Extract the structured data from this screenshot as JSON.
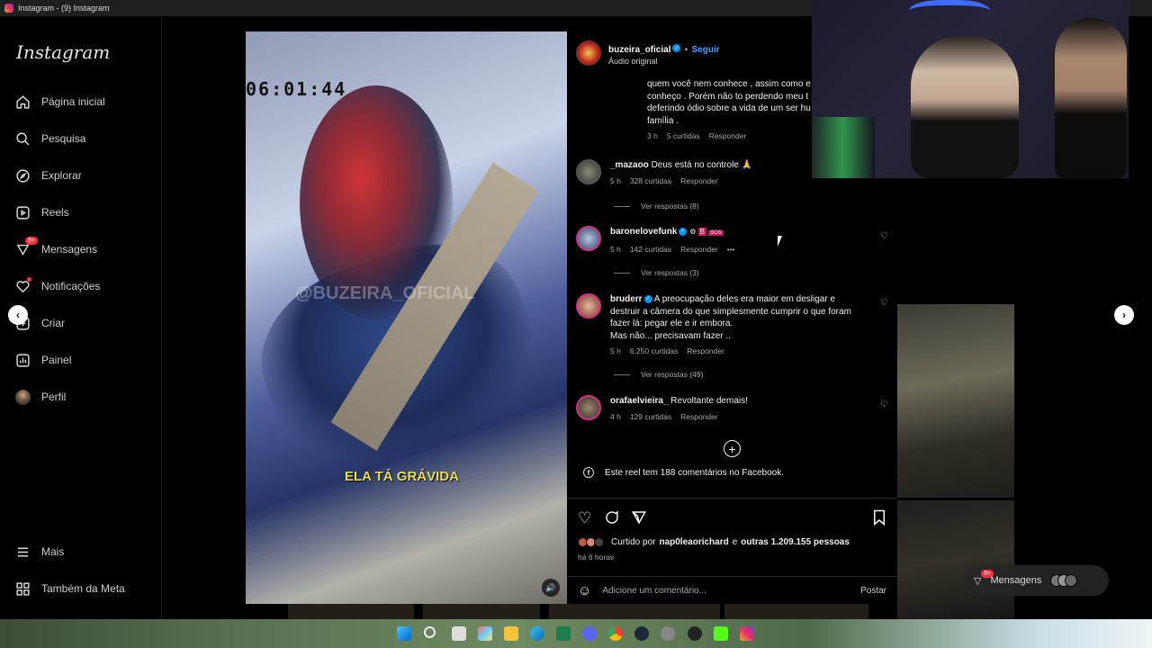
{
  "window": {
    "title": "Instagram - (9) Instagram"
  },
  "sidebar": {
    "logo": "Instagram",
    "items": [
      {
        "label": "Página inicial",
        "icon": "home-icon"
      },
      {
        "label": "Pesquisa",
        "icon": "search-icon"
      },
      {
        "label": "Explorar",
        "icon": "explore-icon"
      },
      {
        "label": "Reels",
        "icon": "reels-icon"
      },
      {
        "label": "Mensagens",
        "icon": "messenger-icon",
        "badge": "9+"
      },
      {
        "label": "Notificações",
        "icon": "heart-icon"
      },
      {
        "label": "Criar",
        "icon": "create-icon"
      },
      {
        "label": "Painel",
        "icon": "dashboard-icon"
      },
      {
        "label": "Perfil",
        "icon": "profile-avatar"
      }
    ],
    "bottom": [
      {
        "label": "Mais",
        "icon": "menu-icon"
      },
      {
        "label": "Também da Meta",
        "icon": "meta-grid-icon"
      }
    ]
  },
  "video": {
    "timestamp": "06:01:44",
    "watermark": "@BUZEIRA_OFICIAL",
    "caption": "ELA TÁ GRÁVIDA"
  },
  "post": {
    "author": "buzeira_oficial",
    "follow_label": "Seguir",
    "audio": "Áudio original",
    "separator": "•"
  },
  "comments": [
    {
      "user": "",
      "text_lines": [
        "quem você nem conhece , assim como e",
        "conheço . Porém não to perdendo meu t",
        "deferindo ódio sobre a vida de um ser hu",
        "família ."
      ],
      "time": "3 h",
      "likes": "5 curtidas",
      "reply": "Responder"
    },
    {
      "user": "_mazaoo",
      "text": "Deus está no controle",
      "time": "5 h",
      "likes": "328 curtidas",
      "reply": "Responder",
      "view_replies": "Ver respostas (8)"
    },
    {
      "user": "baronelovefunk",
      "text": "",
      "time": "5 h",
      "likes": "142 curtidas",
      "reply": "Responder",
      "more": "•••",
      "view_replies": "Ver respostas (3)"
    },
    {
      "user": "bruderr",
      "text_lines": [
        "A preocupação deles era maior em desligar e",
        "destruir a câmera do que simplesmente cumprir o que foram",
        "fazer lá: pegar ele e ir embora.",
        "Mas não... precisavam fazer .."
      ],
      "time": "5 h",
      "likes": "6.250 curtidas",
      "reply": "Responder",
      "view_replies": "Ver respostas (49)"
    },
    {
      "user": "orafaelvieira_",
      "text": "Revoltante demais!",
      "time": "4 h",
      "likes": "129 curtidas",
      "reply": "Responder"
    }
  ],
  "load_more": "+",
  "facebook_note": "Este reel tem 188 comentários no Facebook.",
  "likes_summary": {
    "prefix": "Curtido por",
    "user": "nap0leaorichard",
    "middle": "e",
    "others": "outras 1.209.155 pessoas"
  },
  "posted_ago": "há 6 horas",
  "comment_input": {
    "placeholder": "Adicione um comentário...",
    "post_label": "Postar"
  },
  "messages_pill": {
    "label": "Mensagens",
    "badge": "9+"
  },
  "colors": {
    "accent": "#0095f6",
    "badge": "#ff3040",
    "caption": "#e7dd51"
  }
}
